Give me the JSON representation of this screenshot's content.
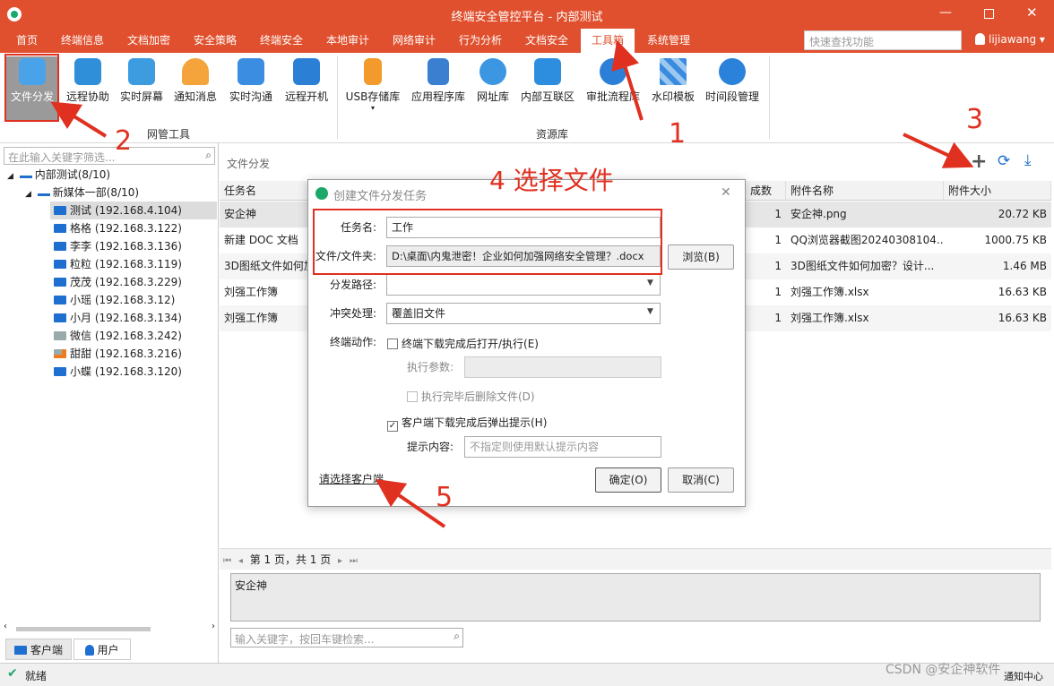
{
  "window": {
    "title": "终端安全管控平台 - 内部测试",
    "user": "lijiawang"
  },
  "menu": [
    "首页",
    "终端信息",
    "文档加密",
    "安全策略",
    "终端安全",
    "本地审计",
    "网络审计",
    "行为分析",
    "文档安全",
    "工具箱",
    "系统管理"
  ],
  "search": {
    "placeholder": "快速查找功能"
  },
  "ribbon": {
    "tools": [
      "文件分发",
      "远程协助",
      "实时屏幕",
      "通知消息",
      "实时沟通",
      "远程开机"
    ],
    "tools_group": "网管工具",
    "resources": [
      "USB存储库",
      "应用程序库",
      "网址库",
      "内部互联区",
      "审批流程库",
      "水印模板",
      "时间段管理"
    ],
    "resources_group": "资源库"
  },
  "left": {
    "filter_placeholder": "在此输入关键字筛选...",
    "root": "内部测试(8/10)",
    "dept": "新媒体一部(8/10)",
    "clients": [
      "测试 (192.168.4.104)",
      "格格 (192.168.3.122)",
      "李李 (192.168.3.136)",
      "粒粒 (192.168.3.119)",
      "茂茂 (192.168.3.229)",
      "小瑶 (192.168.3.12)",
      "小月 (192.168.3.134)",
      "微信 (192.168.3.242)",
      "甜甜 (192.168.3.216)",
      "小蝶 (192.168.3.120)"
    ],
    "tab_clients": "客户端",
    "tab_users": "用户"
  },
  "main": {
    "title": "文件分发",
    "columns": [
      "任务名",
      "成数",
      "附件名称",
      "附件大小"
    ],
    "rows": [
      {
        "name": "安企神",
        "count": "1",
        "file": "安企神.png",
        "size": "20.72 KB"
      },
      {
        "name": "新建 DOC 文档",
        "count": "1",
        "file": "QQ浏览器截图20240308104...",
        "size": "1000.75 KB"
      },
      {
        "name": "3D图纸文件如何加",
        "count": "1",
        "file": "3D图纸文件如何加密？设计...",
        "size": "1.46 MB"
      },
      {
        "name": "刘强工作簿",
        "count": "1",
        "file": "刘强工作簿.xlsx",
        "size": "16.63 KB"
      },
      {
        "name": "刘强工作簿",
        "count": "1",
        "file": "刘强工作簿.xlsx",
        "size": "16.63 KB"
      }
    ],
    "pager": "第 1 页，共 1 页",
    "detail": "安企神",
    "search_placeholder": "输入关键字，按回车键检索..."
  },
  "dialog": {
    "title": "创建文件分发任务",
    "task_label": "任务名:",
    "task_value": "工作",
    "file_label": "文件/文件夹:",
    "file_value": "D:\\桌面\\内鬼泄密！企业如何加强网络安全管理？.docx",
    "browse": "浏览(B)",
    "path_label": "分发路径:",
    "path_value": "",
    "conflict_label": "冲突处理:",
    "conflict_value": "覆盖旧文件",
    "action_label": "终端动作:",
    "open_after": "终端下载完成后打开/执行(E)",
    "param_label": "执行参数:",
    "delete_after": "执行完毕后删除文件(D)",
    "popup": "客户端下载完成后弹出提示(H)",
    "hint_label": "提示内容:",
    "hint_placeholder": "不指定则使用默认提示内容",
    "select_clients": "请选择客户端",
    "ok": "确定(O)",
    "cancel": "取消(C)"
  },
  "annotations": {
    "a1": "1",
    "a2": "2",
    "a3": "3",
    "a4": "4 选择文件",
    "a5": "5"
  },
  "status": {
    "text": "就绪",
    "notify": "通知中心",
    "watermark": "CSDN @安企神软件"
  },
  "colors": {
    "accent": "#e0502e",
    "annotation": "#e03020"
  }
}
